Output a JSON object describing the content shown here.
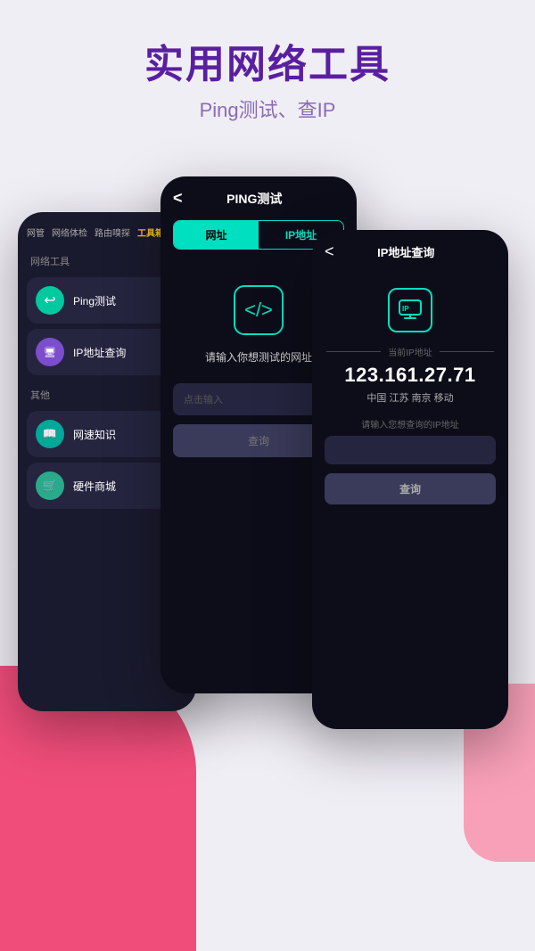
{
  "header": {
    "title": "实用网络工具",
    "subtitle": "Ping测试、查IP"
  },
  "phone1": {
    "tabs": [
      "网管",
      "网络体检",
      "路由嗅探",
      "工具箱"
    ],
    "active_tab": "工具箱",
    "section1_title": "网络工具",
    "section2_title": "其他",
    "items": [
      {
        "icon": "↩",
        "label": "Ping测试",
        "has_arrow": true
      },
      {
        "icon": "🖥",
        "label": "IP地址查询",
        "has_arrow": false
      }
    ],
    "items2": [
      {
        "icon": "📖",
        "label": "网速知识",
        "has_arrow": false
      },
      {
        "icon": "🛒",
        "label": "硬件商城",
        "has_arrow": false
      }
    ]
  },
  "phone2": {
    "back_label": "<",
    "title": "PING测试",
    "tab1": "网址",
    "tab2": "IP地址",
    "hint": "请输入你想测试的网址",
    "input_placeholder": "点击输入",
    "code_icon": "</>",
    "query_label": "查询"
  },
  "phone3": {
    "back_label": "<",
    "title": "IP地址查询",
    "divider_label": "当前IP地址",
    "ip_value": "123.161.27.71",
    "location": "中国 江苏 南京 移动",
    "input_hint": "请输入您想查询的IP地址",
    "query_label": "查询",
    "ip_icon": "IP"
  }
}
